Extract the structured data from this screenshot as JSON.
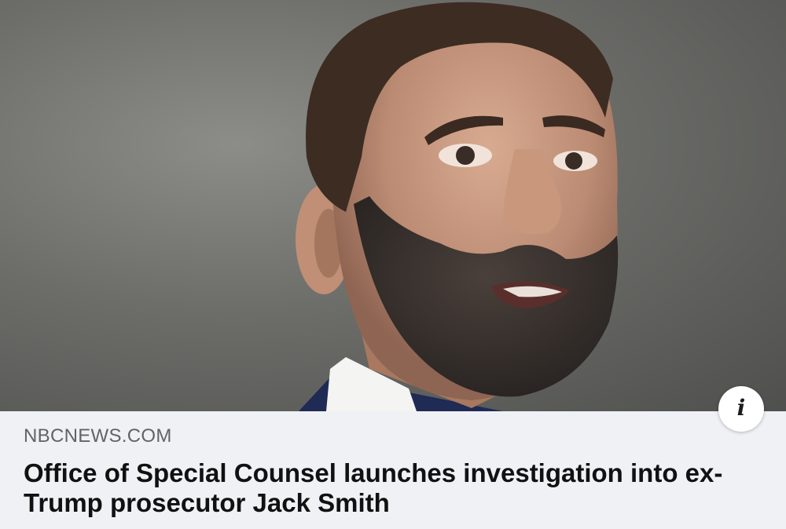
{
  "link_preview": {
    "image_alt": "Jack Smith speaking",
    "info_icon_glyph": "i",
    "source": "NBCNEWS.COM",
    "headline": "Office of Special Counsel launches investigation into ex-Trump prosecutor Jack Smith"
  },
  "icons": {
    "info": "info-icon"
  },
  "colors": {
    "card_background": "#f0f1f5",
    "source_text": "#636366",
    "headline_text": "#111111"
  }
}
